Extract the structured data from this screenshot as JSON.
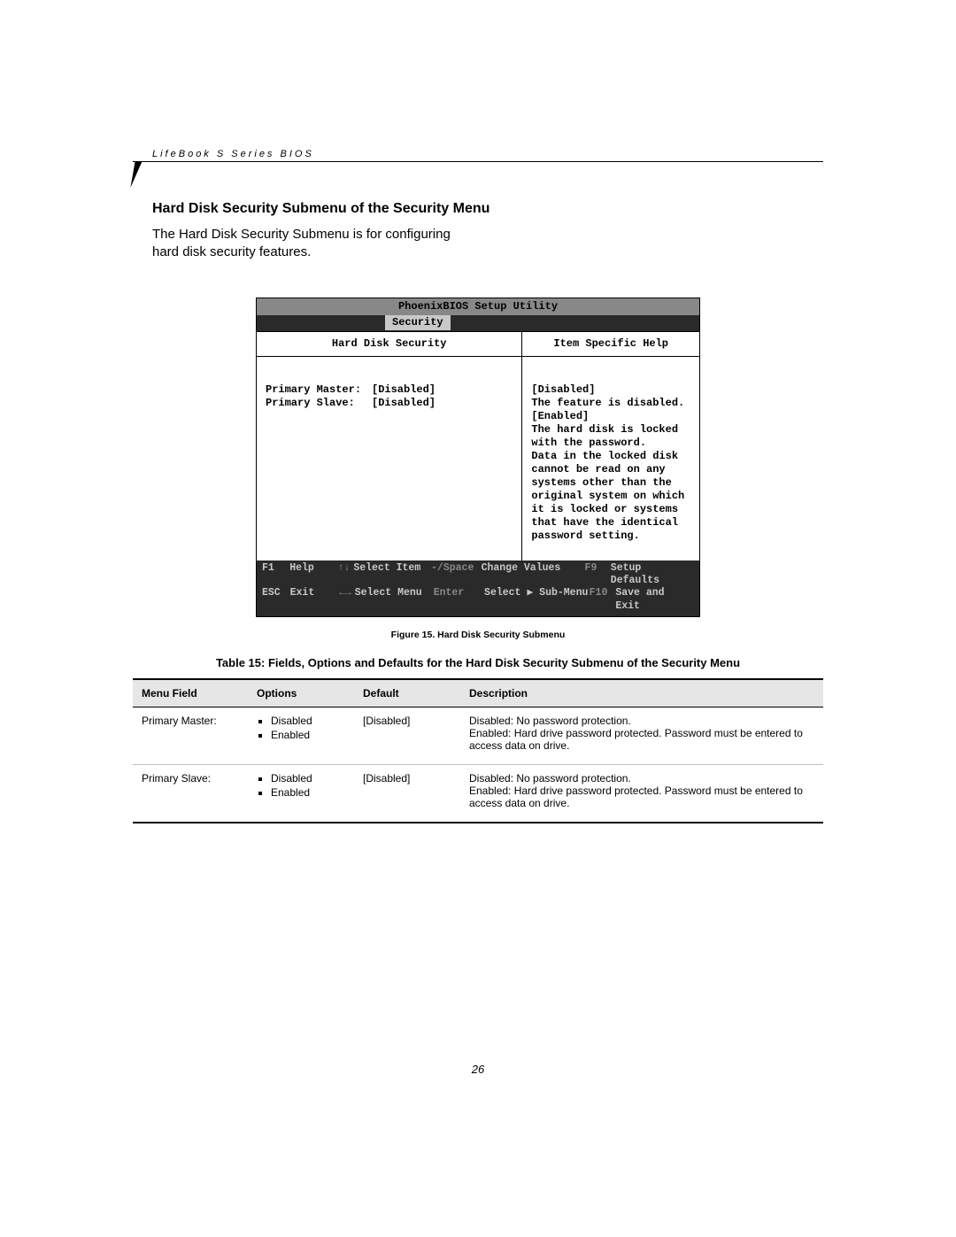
{
  "header": "LifeBook S Series BIOS",
  "heading": "Hard Disk Security Submenu of the Security Menu",
  "intro_lines": [
    "The Hard Disk Security Submenu is for configuring",
    "hard disk security features."
  ],
  "bios": {
    "title": "PhoenixBIOS Setup Utility",
    "tab": "Security",
    "left_heading": "Hard Disk Security",
    "right_heading": "Item Specific Help",
    "rows": [
      {
        "label": "Primary Master:",
        "value": "[Disabled]"
      },
      {
        "label": "Primary Slave:",
        "value": "[Disabled]"
      }
    ],
    "help_lines": [
      "[Disabled]",
      "The feature is disabled.",
      "",
      "[Enabled]",
      "The hard disk is locked",
      "with the password.",
      "Data in the locked disk",
      "cannot be read on any",
      "systems other than the",
      "original system on which",
      "it is locked or systems",
      "that have the identical",
      "password setting."
    ],
    "footer": {
      "r1": {
        "k": "F1",
        "a": "Help",
        "arr": "↑↓",
        "b": "Select Item",
        "c": "-/Space",
        "d": "Change Values",
        "e": "F9",
        "f": "Setup Defaults"
      },
      "r2": {
        "k": "ESC",
        "a": "Exit",
        "arr": "←→",
        "b": "Select Menu",
        "c": "Enter",
        "d": "Select ▶ Sub-Menu",
        "e": "F10",
        "f": "Save and Exit"
      }
    }
  },
  "figure_caption": "Figure 15.  Hard Disk Security Submenu",
  "table_caption": "Table 15: Fields, Options and Defaults for the Hard Disk Security Submenu of the Security Menu",
  "table": {
    "head": {
      "c1": "Menu Field",
      "c2": "Options",
      "c3": "Default",
      "c4": "Description"
    },
    "rows": [
      {
        "field": "Primary Master:",
        "options": [
          "Disabled",
          "Enabled"
        ],
        "default": "[Disabled]",
        "desc": "Disabled: No password protection.\nEnabled: Hard drive password protected. Password must be entered to access data on drive."
      },
      {
        "field": "Primary Slave:",
        "options": [
          "Disabled",
          "Enabled"
        ],
        "default": "[Disabled]",
        "desc": "Disabled: No password protection.\nEnabled: Hard drive password protected. Password must be entered to access data on drive."
      }
    ]
  },
  "page_number": "26"
}
